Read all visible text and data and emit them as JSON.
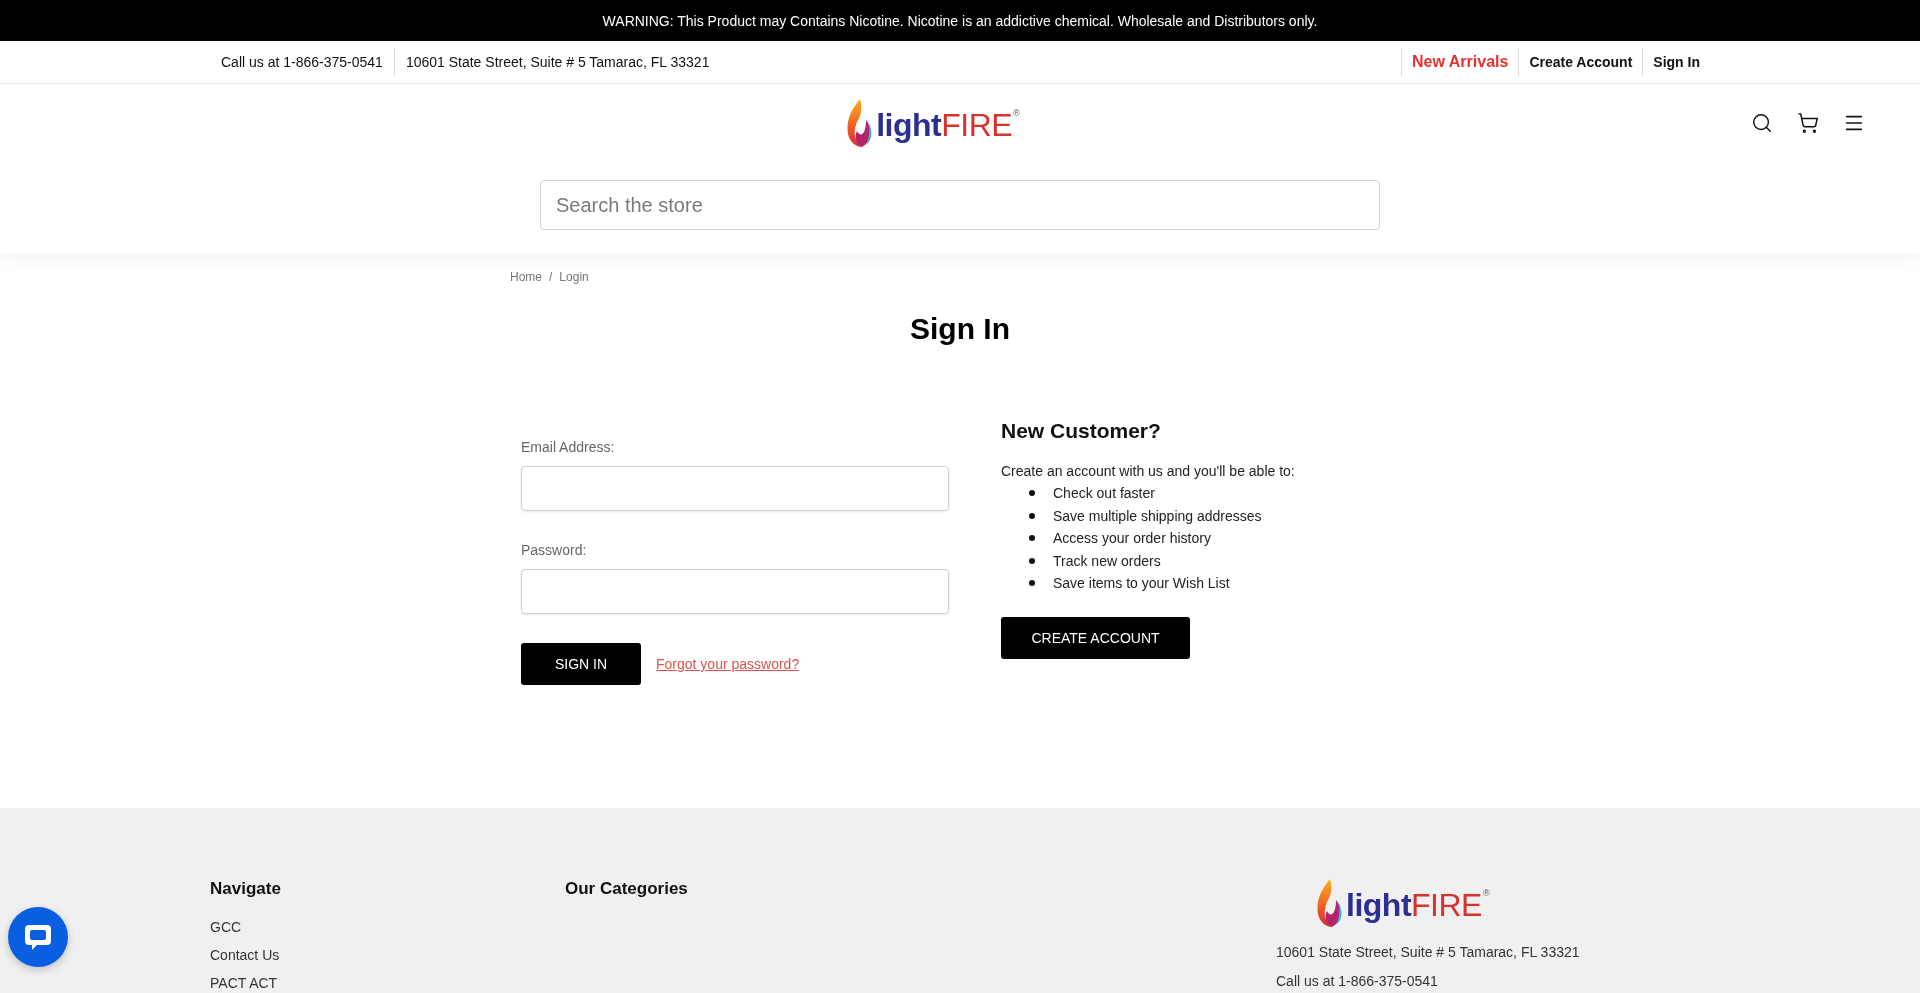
{
  "warning_bar": {
    "text": "WARNING: This Product may Contains Nicotine. Nicotine is an addictive chemical. Wholesale and Distributors only."
  },
  "utility_bar": {
    "contact": [
      "Call us at 1-866-375-0541",
      "10601 State Street, Suite # 5 Tamarac, FL 33321"
    ],
    "links": [
      {
        "label": "New Arrivals",
        "highlighted": true
      },
      {
        "label": "Create Account",
        "highlighted": false
      },
      {
        "label": "Sign In",
        "highlighted": false
      }
    ]
  },
  "header": {
    "logo": {
      "text_1": "light",
      "text_2": "FIRE",
      "registered_mark": "®"
    },
    "search": {
      "placeholder": "Search the store"
    }
  },
  "breadcrumb": {
    "items": [
      "Home",
      "Login"
    ],
    "separator": "/"
  },
  "page_title": "Sign In",
  "login_form": {
    "fields": [
      {
        "label": "Email Address:"
      },
      {
        "label": "Password:"
      }
    ],
    "submit_button": "SIGN IN",
    "forgot_link": "Forgot your password?"
  },
  "new_customer": {
    "title": "New Customer?",
    "intro": "Create an account with us and you'll be able to:",
    "benefits": [
      "Check out faster",
      "Save multiple shipping addresses",
      "Access your order history",
      "Track new orders",
      "Save items to your Wish List"
    ],
    "button": "CREATE ACCOUNT"
  },
  "footer": {
    "columns": [
      {
        "title": "Navigate",
        "links": [
          "GCC",
          "Contact Us",
          "PACT ACT"
        ]
      },
      {
        "title": "Our Categories"
      }
    ],
    "store_info": {
      "logo": {
        "text_1": "light",
        "text_2": "FIRE",
        "registered_mark": "®"
      },
      "address": "10601 State Street, Suite # 5 Tamarac, FL 33321",
      "phone": "Call us at 1-866-375-0541"
    }
  }
}
